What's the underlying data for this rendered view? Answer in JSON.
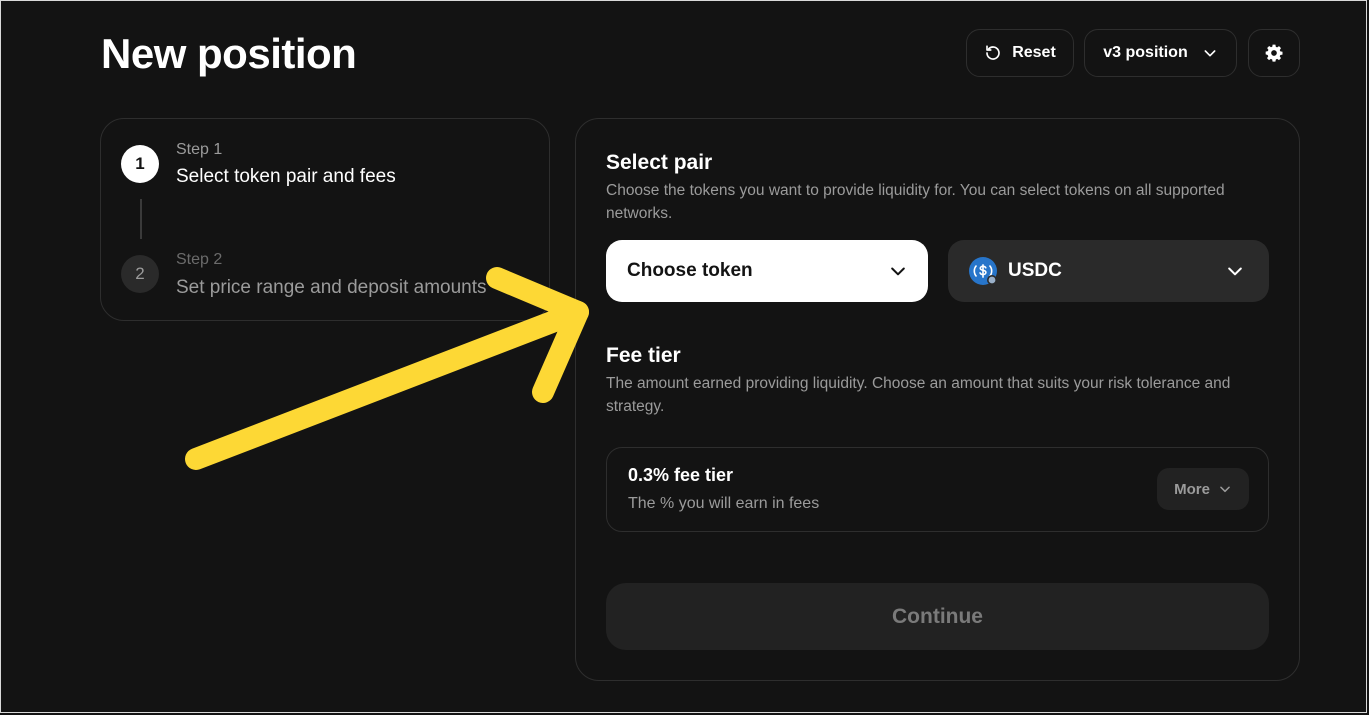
{
  "header": {
    "title": "New position",
    "reset_label": "Reset",
    "version_label": "v3 position"
  },
  "steps": [
    {
      "number": "1",
      "label": "Step 1",
      "title": "Select token pair and fees",
      "active": true
    },
    {
      "number": "2",
      "label": "Step 2",
      "title": "Set price range and deposit amounts",
      "active": false
    }
  ],
  "select_pair": {
    "title": "Select pair",
    "description": "Choose the tokens you want to provide liquidity for. You can select tokens on all supported networks.",
    "token_a_label": "Choose token",
    "token_b_label": "USDC"
  },
  "fee_tier": {
    "title": "Fee tier",
    "description": "The amount earned providing liquidity. Choose an amount that suits your risk tolerance and strategy.",
    "selected": "0.3% fee tier",
    "subtitle": "The % you will earn in fees",
    "more_label": "More"
  },
  "continue_label": "Continue",
  "icons": {
    "reset": "reset-icon",
    "version_dropdown": "chevron-down-icon",
    "settings": "gear-icon",
    "token_b": "usdc-logo-icon",
    "annotation": "yellow-arrow-annotation"
  },
  "colors": {
    "background": "#131313",
    "card_border": "#2e2e2e",
    "muted_text": "#9b9b9b",
    "token_a_bg": "#ffffff",
    "token_b_bg": "#2a2a2a",
    "usdc_blue": "#2775ca",
    "annotation_arrow": "#fdd835"
  }
}
